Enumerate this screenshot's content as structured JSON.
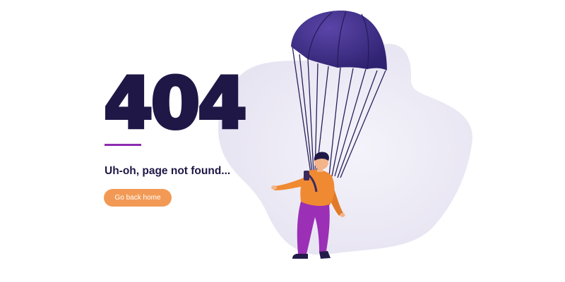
{
  "error": {
    "code": "404",
    "message": "Uh-oh, page not found...",
    "home_button_label": "Go back home"
  },
  "colors": {
    "heading": "#1f1746",
    "divider": "#8e2bb0",
    "button": "#f29a55",
    "blob": "#eceaf5",
    "canopy": "#3d2a84",
    "shirt": "#f08a32",
    "pants": "#9b2fb5"
  },
  "icons": {
    "illustration": "parachutist-illustration"
  }
}
